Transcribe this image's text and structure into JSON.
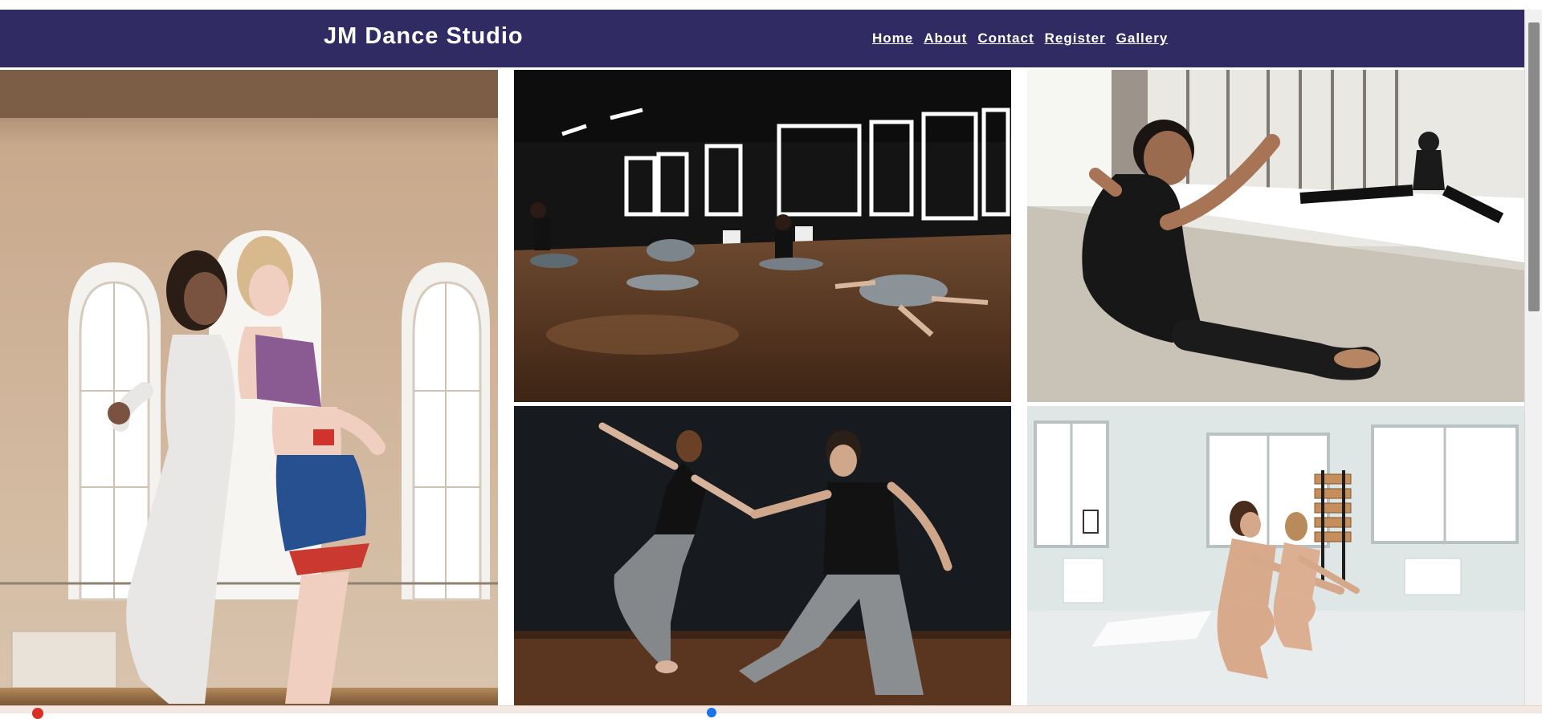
{
  "header": {
    "brand": "JM Dance Studio",
    "nav": [
      {
        "label": "Home"
      },
      {
        "label": "About"
      },
      {
        "label": "Contact"
      },
      {
        "label": "Register"
      },
      {
        "label": "Gallery"
      }
    ]
  },
  "gallery": {
    "photos": [
      {
        "name": "photo-two-women-dancing-window-studio"
      },
      {
        "name": "photo-group-floor-dance-dark-studio"
      },
      {
        "name": "photo-man-stretching-mirror-studio"
      },
      {
        "name": "photo-couple-dance-black-backdrop"
      },
      {
        "name": "photo-two-women-squat-bright-studio"
      }
    ]
  },
  "colors": {
    "navbar": "#302b63",
    "nav_text": "#ffffff",
    "page_background": "#ffffff"
  }
}
